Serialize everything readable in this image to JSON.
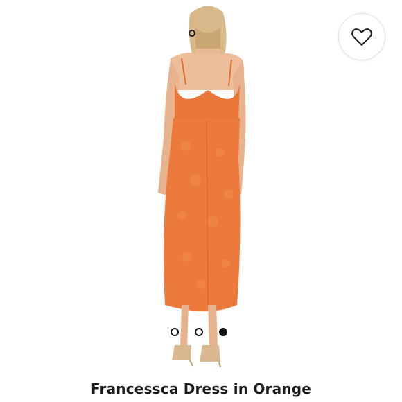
{
  "product": {
    "title": "Francessca Dress in Orange",
    "image_alt": "Back view of model wearing orange satin jacquard slip midi dress with strappy heels",
    "accent_color": "#e97531"
  },
  "favorite": {
    "icon": "heart-outline-icon"
  },
  "carousel": {
    "dots": [
      {
        "state": "inactive"
      },
      {
        "state": "inactive"
      },
      {
        "state": "active"
      }
    ]
  }
}
